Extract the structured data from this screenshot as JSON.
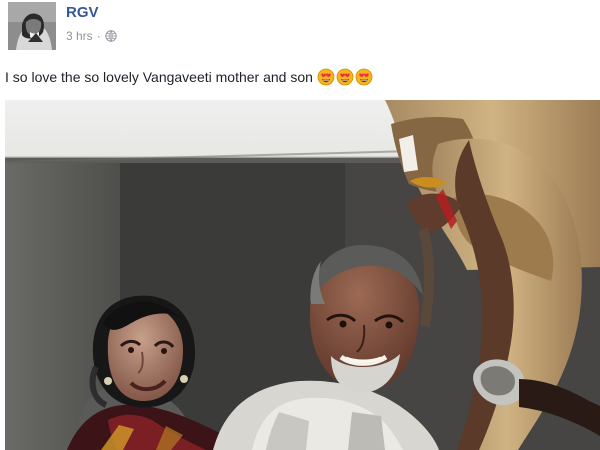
{
  "post": {
    "author": "RGV",
    "timestamp": "3 hrs",
    "separator": "·",
    "privacy_icon": "globe-icon",
    "text": "I so love the so lovely Vangaveeti mother and son",
    "emoji": [
      "heart-eyes-emoji-icon",
      "heart-eyes-emoji-icon",
      "heart-eyes-emoji-icon"
    ],
    "avatar_icon": "avatar-icon",
    "photo_icon": "post-photo"
  },
  "colors": {
    "author_link": "#365899",
    "meta_text": "#90949c",
    "body_text": "#1d2129"
  }
}
